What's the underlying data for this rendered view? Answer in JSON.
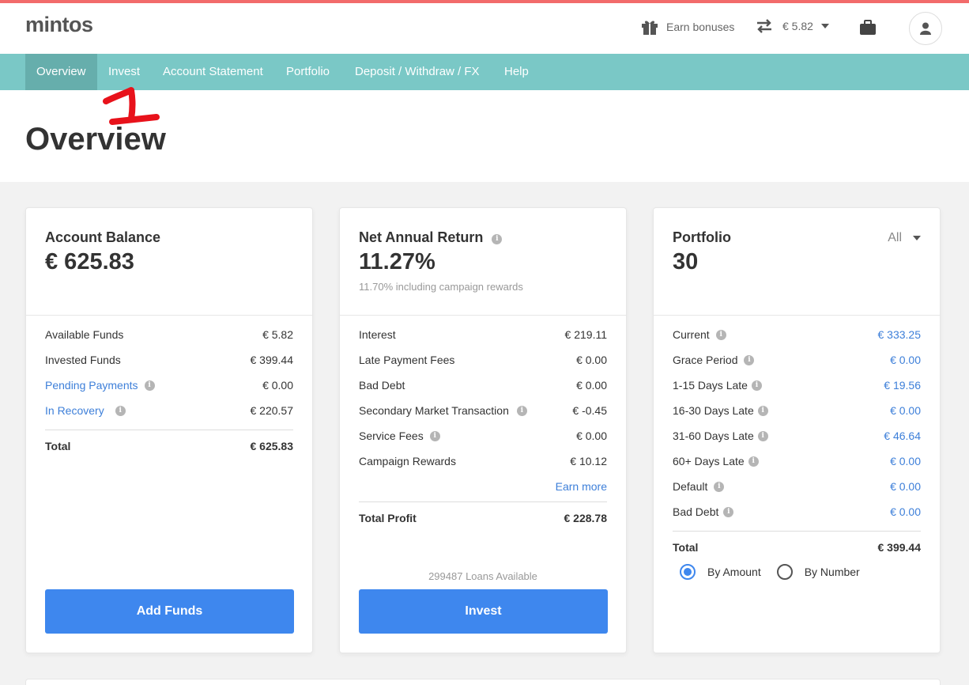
{
  "header": {
    "logo": "mintos",
    "earn_bonuses": "Earn bonuses",
    "balance": "€ 5.82"
  },
  "nav": {
    "items": [
      {
        "label": "Overview"
      },
      {
        "label": "Invest"
      },
      {
        "label": "Account Statement"
      },
      {
        "label": "Portfolio"
      },
      {
        "label": "Deposit / Withdraw / FX"
      },
      {
        "label": "Help"
      }
    ]
  },
  "page": {
    "title": "Overview"
  },
  "account_balance": {
    "title": "Account Balance",
    "value": "€ 625.83",
    "rows": [
      {
        "label": "Available Funds",
        "value": "€ 5.82"
      },
      {
        "label": "Invested Funds",
        "value": "€ 399.44"
      },
      {
        "label": "Pending Payments",
        "value": "€ 0.00"
      },
      {
        "label": "In Recovery",
        "value": "€ 220.57"
      }
    ],
    "total_label": "Total",
    "total_value": "€ 625.83",
    "button": "Add Funds"
  },
  "net_return": {
    "title": "Net Annual Return",
    "value": "11.27%",
    "subtitle": "11.70% including campaign rewards",
    "rows": [
      {
        "label": "Interest",
        "value": "€ 219.11"
      },
      {
        "label": "Late Payment Fees",
        "value": "€ 0.00"
      },
      {
        "label": "Bad Debt",
        "value": "€ 0.00"
      },
      {
        "label": "Secondary Market Transaction",
        "value": "€ -0.45"
      },
      {
        "label": "Service Fees",
        "value": "€ 0.00"
      },
      {
        "label": "Campaign Rewards",
        "value": "€ 10.12"
      }
    ],
    "earn_more": "Earn more",
    "total_label": "Total Profit",
    "total_value": "€ 228.78",
    "loans_available": "299487 Loans Available",
    "button": "Invest"
  },
  "portfolio": {
    "title": "Portfolio",
    "value": "30",
    "filter": "All",
    "rows": [
      {
        "label": "Current",
        "value": "€ 333.25"
      },
      {
        "label": "Grace Period",
        "value": "€ 0.00"
      },
      {
        "label": "1-15 Days Late",
        "value": "€ 19.56"
      },
      {
        "label": "16-30 Days Late",
        "value": "€ 0.00"
      },
      {
        "label": "31-60 Days Late",
        "value": "€ 46.64"
      },
      {
        "label": "60+ Days Late",
        "value": "€ 0.00"
      },
      {
        "label": "Default",
        "value": "€ 0.00"
      },
      {
        "label": "Bad Debt",
        "value": "€ 0.00"
      }
    ],
    "total_label": "Total",
    "total_value": "€ 399.44",
    "radio_amount": "By Amount",
    "radio_number": "By Number",
    "selected_radio": "By Amount"
  },
  "annotation": {
    "text": "1",
    "color": "#e8121b"
  },
  "colors": {
    "accent_nav": "#7ac8c6",
    "button": "#3e87ee",
    "link": "#3d7fd9"
  }
}
